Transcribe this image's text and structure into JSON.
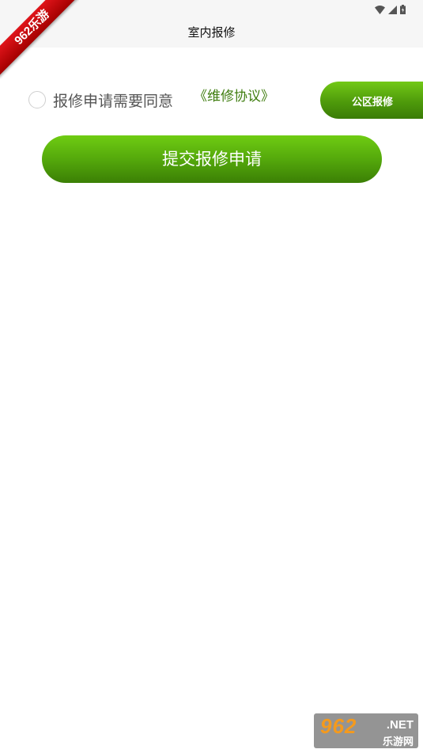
{
  "app_bar": {
    "title": "室内报修"
  },
  "ribbon": {
    "label": "962乐游"
  },
  "agreement": {
    "text": "报修申请需要同意",
    "link_label": "《维修协议》",
    "checked": false
  },
  "actions": {
    "public_repair_label": "公区报修",
    "submit_label": "提交报修申请"
  },
  "watermark": {
    "top": "962",
    "net": ".NET",
    "bottom": "乐游网"
  },
  "status_bar": {
    "icons": [
      "wifi-icon",
      "signal-icon",
      "battery-icon"
    ]
  },
  "colors": {
    "accent_green": "#52a50b",
    "link_green": "#3f7d0f",
    "ribbon_red": "#c80000"
  }
}
